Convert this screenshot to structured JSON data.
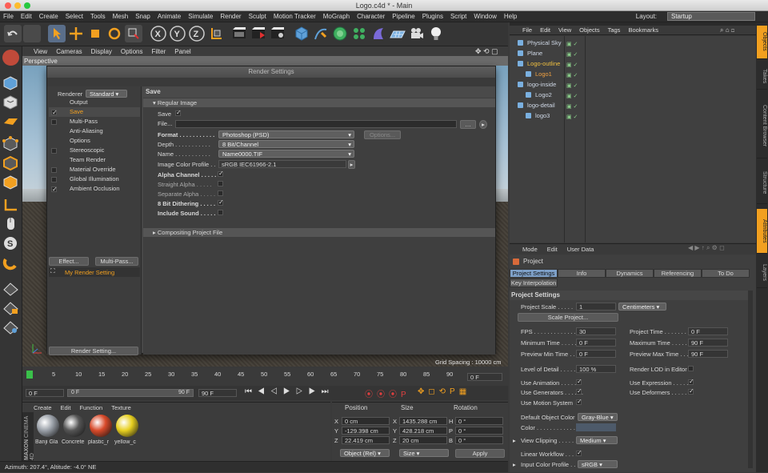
{
  "window": {
    "title": "Logo.c4d * - Main"
  },
  "menu": [
    "File",
    "Edit",
    "Create",
    "Select",
    "Tools",
    "Mesh",
    "Snap",
    "Animate",
    "Simulate",
    "Render",
    "Sculpt",
    "Motion Tracker",
    "MoGraph",
    "Character",
    "Pipeline",
    "Plugins",
    "Script",
    "Window",
    "Help"
  ],
  "layout": {
    "label": "Layout:",
    "value": "Startup"
  },
  "viewport": {
    "menu": [
      "View",
      "Cameras",
      "Display",
      "Options",
      "Filter",
      "Panel"
    ],
    "label": "Perspective",
    "grid_spacing": "Grid Spacing : 10000 cm"
  },
  "render_settings": {
    "title": "Render Settings",
    "renderer_label": "Renderer",
    "renderer_value": "Standard",
    "categories": [
      {
        "label": "Output",
        "checkbox": false,
        "checked": false
      },
      {
        "label": "Save",
        "checkbox": true,
        "checked": true,
        "selected": true
      },
      {
        "label": "Multi-Pass",
        "checkbox": true,
        "checked": false
      },
      {
        "label": "Anti-Aliasing",
        "checkbox": false,
        "checked": false
      },
      {
        "label": "Options",
        "checkbox": false,
        "checked": false
      },
      {
        "label": "Stereoscopic",
        "checkbox": true,
        "checked": false
      },
      {
        "label": "Team Render",
        "checkbox": false,
        "checked": false
      },
      {
        "label": "Material Override",
        "checkbox": true,
        "checked": false
      },
      {
        "label": "Global Illumination",
        "checkbox": true,
        "checked": false
      },
      {
        "label": "Ambient Occlusion",
        "checkbox": true,
        "checked": true
      }
    ],
    "effect_btn": "Effect...",
    "multipass_btn": "Multi-Pass...",
    "preset": "My Render Setting",
    "render_setting_btn": "Render Setting...",
    "section_title": "Save",
    "regular_image": "Regular Image",
    "save_label": "Save",
    "file_label": "File...",
    "format_label": "Format . . . . . . . . . . .",
    "format_value": "Photoshop (PSD)",
    "options_btn": "Options...",
    "depth_label": "Depth . . . . . . . . . . .",
    "depth_value": "8 Bit/Channel",
    "name_label": "Name . . . . . . . . . . .",
    "name_value": "Name0000.TIF",
    "profile_label": "Image Color Profile . .",
    "profile_value": "sRGB IEC61966-2.1",
    "alpha_label": "Alpha Channel . . . . .",
    "straight_label": "Straight Alpha . . . . .",
    "separate_label": "Separate Alpha . . . . .",
    "dither_label": "8 Bit Dithering . . . . .",
    "sound_label": "Include Sound . . . . .",
    "compositing": "Compositing Project File"
  },
  "objects": {
    "menu": [
      "File",
      "Edit",
      "View",
      "Objects",
      "Tags",
      "Bookmarks"
    ],
    "rows": [
      {
        "name": "Physical Sky",
        "indent": 0,
        "color": "#cfd8e6"
      },
      {
        "name": "Plane",
        "indent": 0,
        "color": "#cfd8e6"
      },
      {
        "name": "Logo-outline",
        "indent": 0,
        "color": "#f0c040"
      },
      {
        "name": "Logo1",
        "indent": 1,
        "color": "#f0a040"
      },
      {
        "name": "logo-inside",
        "indent": 0,
        "color": "#cfd8e6"
      },
      {
        "name": "Logo2",
        "indent": 1,
        "color": "#cfd8e6"
      },
      {
        "name": "logo-detail",
        "indent": 0,
        "color": "#cfd8e6"
      },
      {
        "name": "logo3",
        "indent": 1,
        "color": "#cfd8e6"
      }
    ]
  },
  "side_tabs": [
    "Objects",
    "Takes",
    "Content Browser",
    "Structure",
    "Attributes",
    "Layers"
  ],
  "attributes": {
    "menu": [
      "Mode",
      "Edit",
      "User Data"
    ],
    "object": "Project",
    "tabs": [
      "Project Settings",
      "Info",
      "Dynamics",
      "Referencing",
      "To Do"
    ],
    "tab2": "Key Interpolation",
    "section": "Project Settings",
    "project_scale_label": "Project Scale . . . . .",
    "project_scale_value": "1",
    "project_scale_unit": "Centimeters",
    "scale_btn": "Scale Project...",
    "fps_label": "FPS . . . . . . . . . . . . . .",
    "fps_value": "30",
    "project_time_label": "Project Time . . . . . . .",
    "project_time_value": "0 F",
    "min_time_label": "Minimum Time . . . . . .",
    "min_time_value": "0 F",
    "max_time_label": "Maximum Time . . . . . .",
    "max_time_value": "90 F",
    "prev_min_label": "Preview Min Time . . . .",
    "prev_min_value": "0 F",
    "prev_max_label": "Preview Max Time . . . .",
    "prev_max_value": "90 F",
    "lod_label": "Level of Detail . . . . .",
    "lod_value": "100 %",
    "render_lod_label": "Render LOD in Editor",
    "use_anim_label": "Use Animation . . . . . .",
    "use_expr_label": "Use Expression . . . . . .",
    "use_gen_label": "Use Generators . . . . . .",
    "use_def_label": "Use Deformers . . . . . .",
    "use_motion_label": "Use Motion System",
    "default_color_label": "Default Object Color",
    "default_color_value": "Gray-Blue",
    "color_label": "Color . . . . . . . . . . . .",
    "clipping_label": "View Clipping . . . . . .",
    "clipping_value": "Medium",
    "linear_label": "Linear Workflow . . . . .",
    "input_profile_label": "Input Color Profile . . .",
    "input_profile_value": "sRGB"
  },
  "timeline": {
    "ticks": [
      "0",
      "5",
      "10",
      "15",
      "20",
      "25",
      "30",
      "35",
      "40",
      "45",
      "50",
      "55",
      "60",
      "65",
      "70",
      "75",
      "80",
      "85",
      "90"
    ],
    "current": "0 F"
  },
  "transport": {
    "start": "0 F",
    "range_start": "0 F",
    "range_end": "90 F",
    "end": "90 F"
  },
  "materials": {
    "menu": [
      "Create",
      "Edit",
      "Function",
      "Texture"
    ],
    "items": [
      {
        "name": "Banji Gla",
        "color": "#9aa0a8"
      },
      {
        "name": "Concrete",
        "color": "#555555"
      },
      {
        "name": "plastic_r",
        "color": "#d84a2a"
      },
      {
        "name": "yellow_c",
        "color": "#e8d020"
      }
    ],
    "brand_top": "MAXON",
    "brand_bottom": "CINEMA 4D"
  },
  "coordinates": {
    "headers": [
      "Position",
      "Size",
      "Rotation"
    ],
    "rows": [
      {
        "axis": "X",
        "pos": "0 cm",
        "size": "1435.288 cm",
        "rot_label": "H",
        "rot": "0 °"
      },
      {
        "axis": "Y",
        "pos": "-129.398 cm",
        "size": "428.218 cm",
        "rot_label": "P",
        "rot": "0 °"
      },
      {
        "axis": "Z",
        "pos": "22.419 cm",
        "size": "20 cm",
        "rot_label": "B",
        "rot": "0 °"
      }
    ],
    "mode": "Object (Rel)",
    "size_mode": "Size",
    "apply": "Apply"
  },
  "status": "Azimuth: 207.4°, Altitude: -4.0°  NE"
}
